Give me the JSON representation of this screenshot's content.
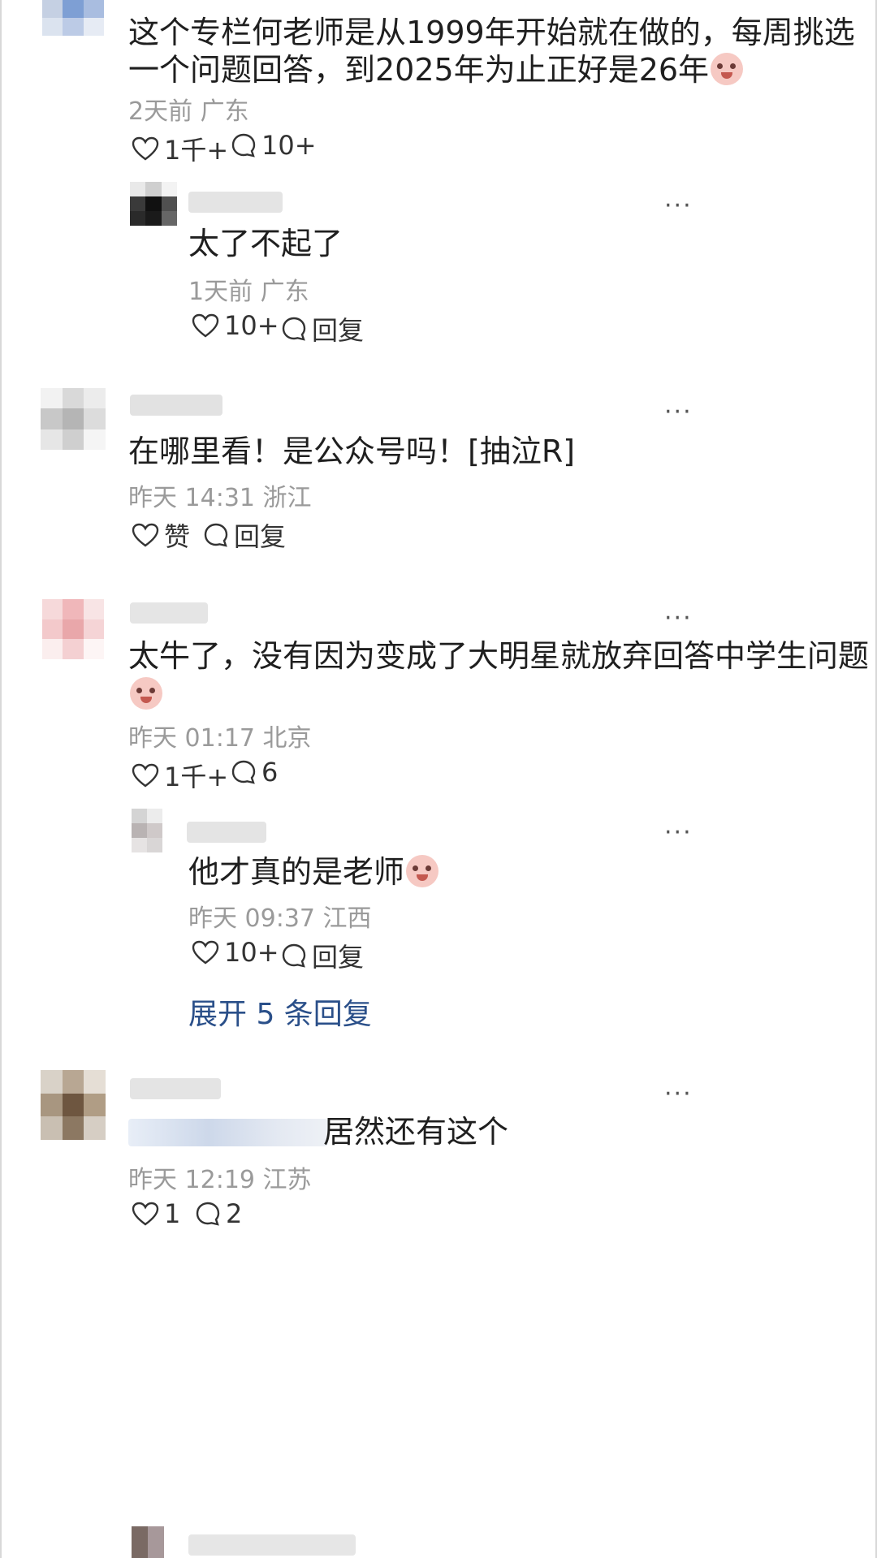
{
  "comments": [
    {
      "text_lines": [
        "这个专栏何老师是从1999年开始就在做的，每周挑选",
        "一个问题回答，到2025年为止正好是26年"
      ],
      "meta": "2天前 广东",
      "likes": "1千+",
      "comments": "10+"
    },
    {
      "text_lines": [
        "太了不起了"
      ],
      "meta": "1天前 广东",
      "likes": "10+",
      "comments": "回复"
    },
    {
      "text_lines": [
        "在哪里看！是公众号吗！[抽泣R]"
      ],
      "meta": "昨天 14:31 浙江",
      "likes": "赞",
      "comments": "回复"
    },
    {
      "text_lines": [
        "太牛了，没有因为变成了大明星就放弃回答中学生问题"
      ],
      "meta": "昨天 01:17 北京",
      "likes": "1千+",
      "comments": "6"
    },
    {
      "text_lines": [
        "他才真的是老师"
      ],
      "meta": "昨天 09:37 江西",
      "likes": "10+",
      "comments": "回复"
    },
    {
      "text_lines": [
        "居然还有这个"
      ],
      "meta": "昨天 12:19 江苏",
      "likes": "1",
      "comments": "2"
    }
  ],
  "expand_replies": "展开 5 条回复",
  "more_label": "···",
  "icons": {
    "like": "heart-icon",
    "comment": "comment-bubble-icon",
    "more": "more-icon",
    "emoji": "crying-face-emoji"
  }
}
